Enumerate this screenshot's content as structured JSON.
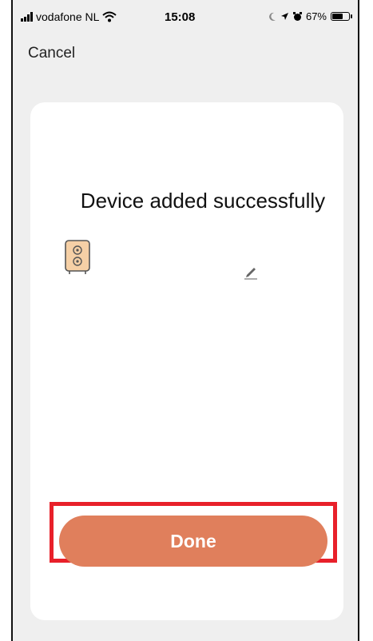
{
  "status_bar": {
    "carrier": "vodafone NL",
    "time": "15:08",
    "battery_percent": "67%",
    "battery_level": 0.67,
    "icons": [
      "signal-icon",
      "wifi-icon",
      "moon-icon",
      "location-icon",
      "alarm-icon",
      "battery-icon"
    ]
  },
  "nav": {
    "cancel_label": "Cancel"
  },
  "card": {
    "title": "Device added successfully",
    "device_icon": "speaker-device-icon",
    "edit_icon": "pencil-icon"
  },
  "actions": {
    "done_label": "Done",
    "highlight_color": "#e8202a",
    "button_color": "#e07f5c"
  }
}
